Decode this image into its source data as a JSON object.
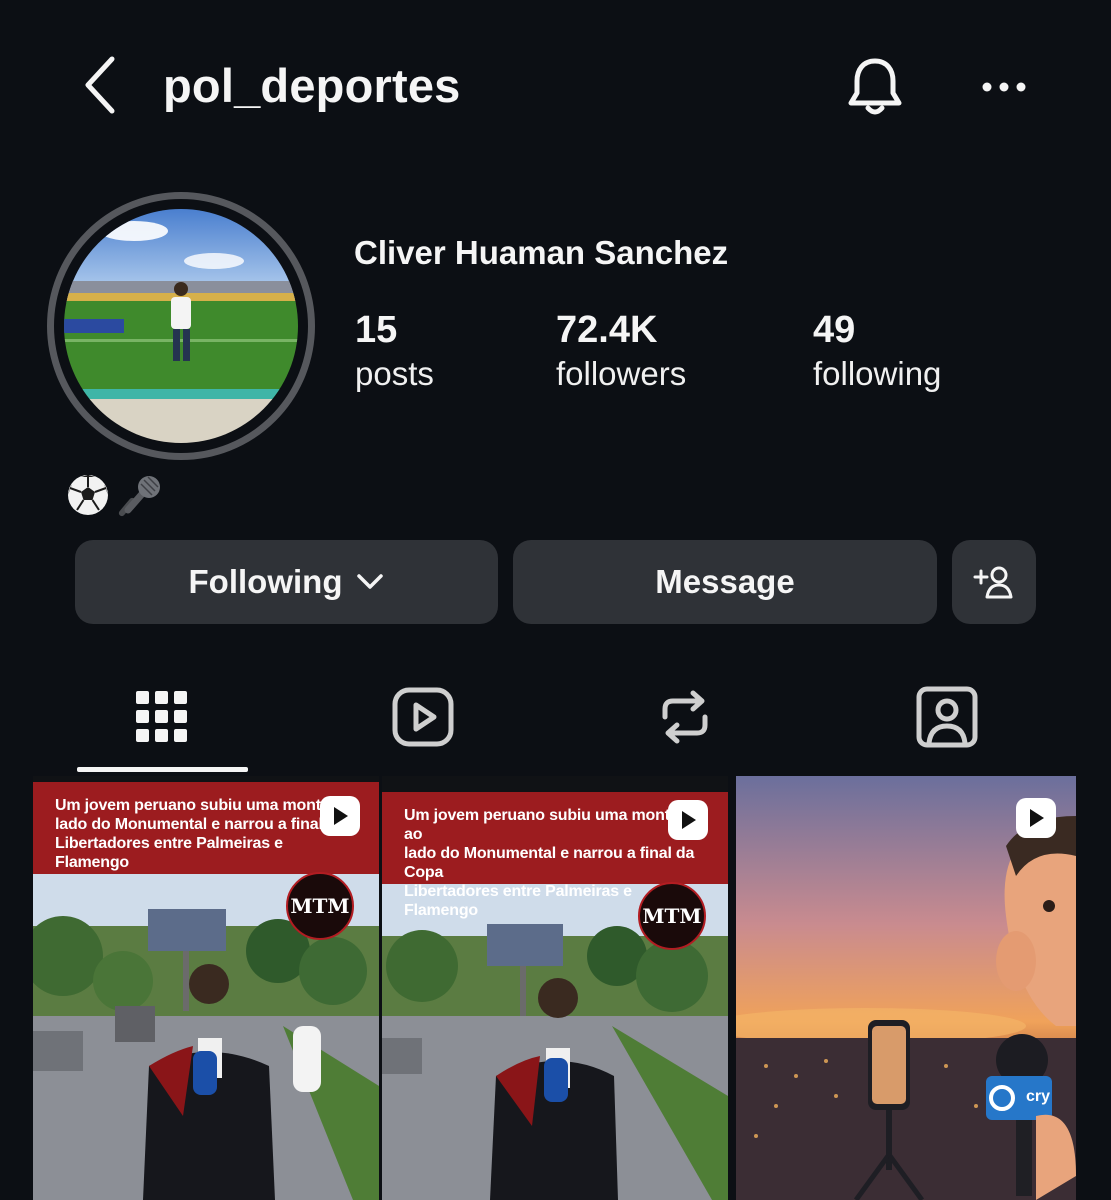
{
  "header": {
    "username": "pol_deportes",
    "back_icon": "chevron-left-icon",
    "bell_icon": "bell-icon",
    "more_icon": "more-horizontal-icon"
  },
  "profile": {
    "full_name": "Cliver Huaman Sanchez",
    "bio": "⚽🎤",
    "stats": {
      "posts": {
        "value": "15",
        "label": "posts"
      },
      "followers": {
        "value": "72.4K",
        "label": "followers"
      },
      "following": {
        "value": "49",
        "label": "following"
      }
    }
  },
  "actions": {
    "following_label": "Following",
    "message_label": "Message",
    "suggest_icon": "add-person-icon"
  },
  "tabs": [
    {
      "name": "grid",
      "icon": "grid-icon",
      "active": true
    },
    {
      "name": "reels",
      "icon": "reels-icon",
      "active": false
    },
    {
      "name": "reposts",
      "icon": "repost-icon",
      "active": false
    },
    {
      "name": "tagged",
      "icon": "tagged-person-icon",
      "active": false
    }
  ],
  "posts": [
    {
      "banner_lines": [
        "Um jovem peruano subiu uma montanh",
        "lado do Monumental e narrou a final da",
        "Libertadores entre Palmeiras e Flamengo"
      ],
      "logo": "MTM",
      "type": "reel"
    },
    {
      "banner_lines": [
        "Um jovem peruano subiu uma montanh ao",
        "lado do Monumental e narrou a final da Copa",
        "Libertadores entre Palmeiras e Flamengo"
      ],
      "logo": "MTM",
      "type": "reel"
    },
    {
      "mic_label": "cry",
      "type": "reel"
    }
  ],
  "colors": {
    "background": "#0c0f14",
    "button": "#2f3237",
    "banner": "#9c1c1f",
    "text": "#f5f5f5"
  }
}
